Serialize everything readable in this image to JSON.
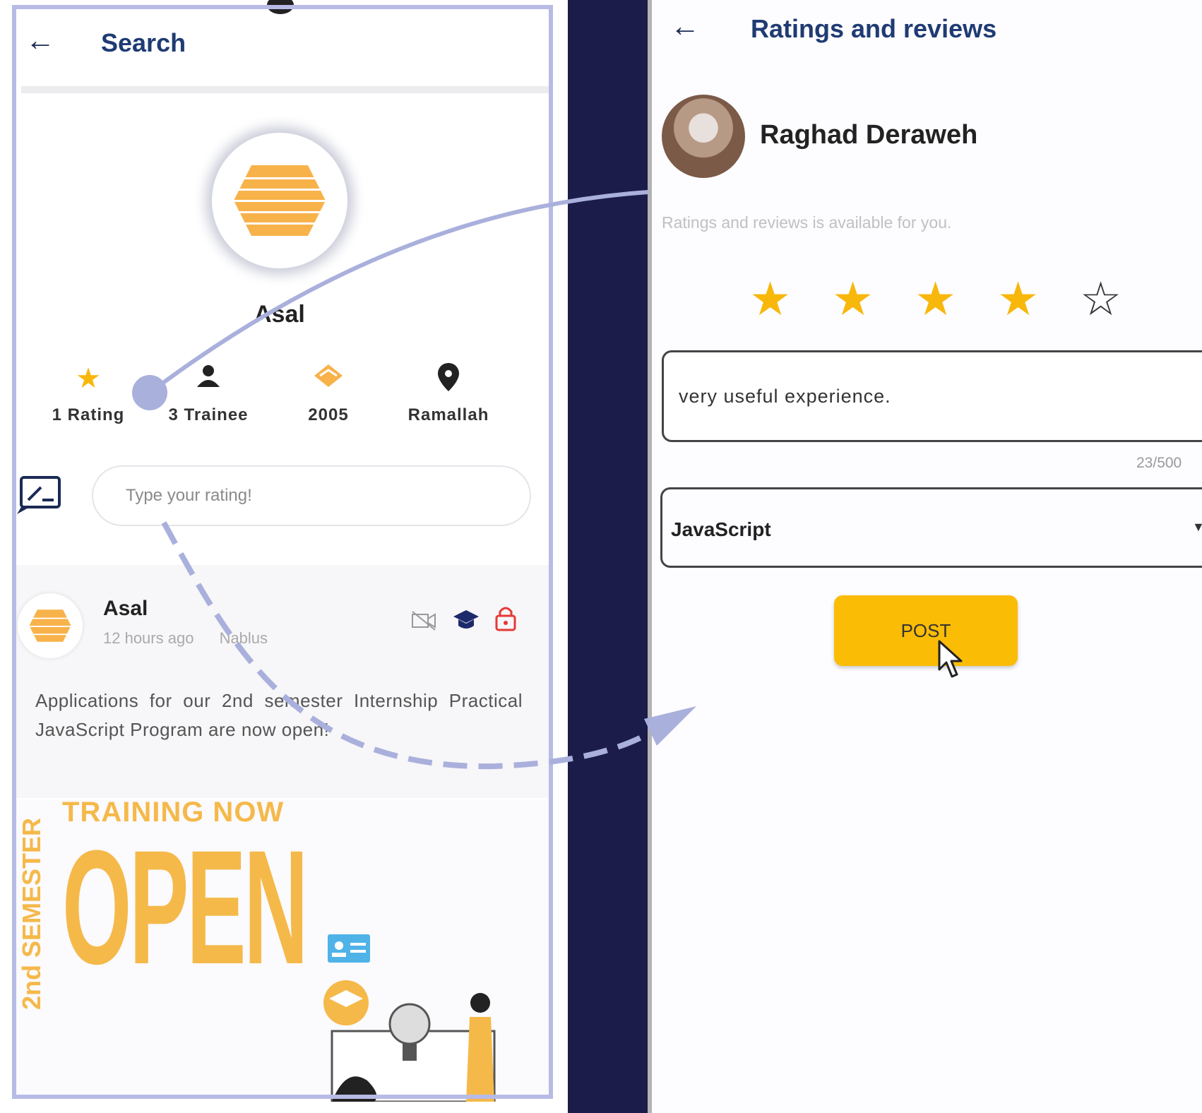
{
  "left_screen": {
    "header": {
      "back_icon": "arrow-left-icon",
      "title": "Search"
    },
    "profile": {
      "name": "Asal"
    },
    "stats": [
      {
        "icon": "star-icon",
        "label": "1 Rating"
      },
      {
        "icon": "person-icon",
        "label": "3 Trainee"
      },
      {
        "icon": "handshake-icon",
        "label": "2005"
      },
      {
        "icon": "location-pin-icon",
        "label": "Ramallah"
      }
    ],
    "rating_input": {
      "placeholder": "Type your rating!"
    },
    "post": {
      "author": "Asal",
      "time": "12 hours ago",
      "location": "Nablus",
      "text": "Applications for our 2nd semester Internship Practical JavaScript Program are now open!"
    },
    "banner": {
      "vertical_text": "2nd SEMESTER",
      "headline": "TRAINING NOW",
      "big_text": "OPEN"
    }
  },
  "right_screen": {
    "header": {
      "back_icon": "arrow-left-icon",
      "title": "Ratings and reviews"
    },
    "user_name": "Raghad Deraweh",
    "hint": "Ratings and reviews is available for you.",
    "rating_value": 4,
    "rating_max": 5,
    "review_text": "very useful experience.",
    "char_counter": "23/500",
    "course_select": "JavaScript",
    "post_button": "POST"
  },
  "colors": {
    "accent": "#fbbc05",
    "star": "#f8b70b",
    "title": "#1f3b73",
    "connector": "#aab0dc"
  }
}
